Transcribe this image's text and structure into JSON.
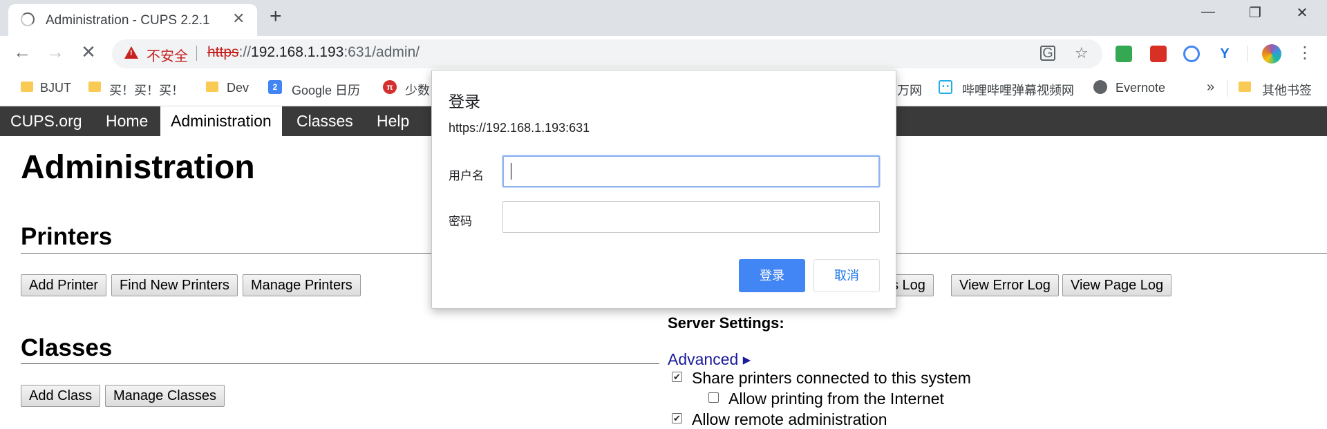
{
  "browser": {
    "tab_title": "Administration - CUPS 2.2.1",
    "tab_close": "✕",
    "new_tab": "+",
    "window": {
      "minimize": "—",
      "restore": "❐",
      "close": "✕"
    },
    "nav": {
      "back": "←",
      "forward": "→",
      "stop": "✕"
    },
    "security_label": "不安全",
    "url": {
      "scheme": "https",
      "sep": "://",
      "host": "192.168.1.193",
      "rest": ":631/admin/"
    },
    "omnibox_icons": [
      "translate-icon",
      "star-icon"
    ],
    "extensions": [
      {
        "name": "download-extension-icon",
        "color": "#34a853"
      },
      {
        "name": "dots-extension-icon",
        "color": "#d93025"
      },
      {
        "name": "check-extension-icon",
        "color": "#4285f4"
      },
      {
        "name": "y-extension-icon",
        "color": "#1a73e8"
      }
    ],
    "menu": "⋮"
  },
  "bookmarks": {
    "items": [
      {
        "label": "BJUT",
        "icon": "folder"
      },
      {
        "label": "买！买！买！",
        "icon": "folder"
      },
      {
        "label": "Dev",
        "icon": "folder"
      },
      {
        "label": "Google 日历",
        "icon": "calendar",
        "icon_text": "2"
      },
      {
        "label": "少数",
        "icon": "pi",
        "icon_text": "π"
      },
      {
        "label": "万网",
        "icon": "none"
      },
      {
        "label": "哔哩哔哩弹幕视频网",
        "icon": "bilibili"
      },
      {
        "label": "Evernote",
        "icon": "globe"
      }
    ],
    "overflow": "»",
    "other": "其他书签"
  },
  "cups_nav": [
    {
      "label": "CUPS.org",
      "active": false
    },
    {
      "label": "Home",
      "active": false
    },
    {
      "label": "Administration",
      "active": true
    },
    {
      "label": "Classes",
      "active": false
    },
    {
      "label": "Help",
      "active": false
    }
  ],
  "page": {
    "title": "Administration",
    "printers": {
      "heading": "Printers",
      "buttons": [
        "Add Printer",
        "Find New Printers",
        "Manage Printers"
      ]
    },
    "classes": {
      "heading": "Classes",
      "buttons": [
        "Add Class",
        "Manage Classes"
      ]
    },
    "server": {
      "log_buttons": [
        "ss Log",
        "View Error Log",
        "View Page Log"
      ],
      "settings_heading": "Server Settings:",
      "advanced_link": "Advanced ▸",
      "options": [
        {
          "label": "Share printers connected to this system",
          "checked": true
        },
        {
          "label": "Allow printing from the Internet",
          "checked": false
        },
        {
          "label": "Allow remote administration",
          "checked": true
        }
      ]
    }
  },
  "dialog": {
    "title": "登录",
    "origin": "https://192.168.1.193:631",
    "username_label": "用户名",
    "username_value": "",
    "password_label": "密码",
    "password_value": "",
    "ok_label": "登录",
    "cancel_label": "取消"
  }
}
